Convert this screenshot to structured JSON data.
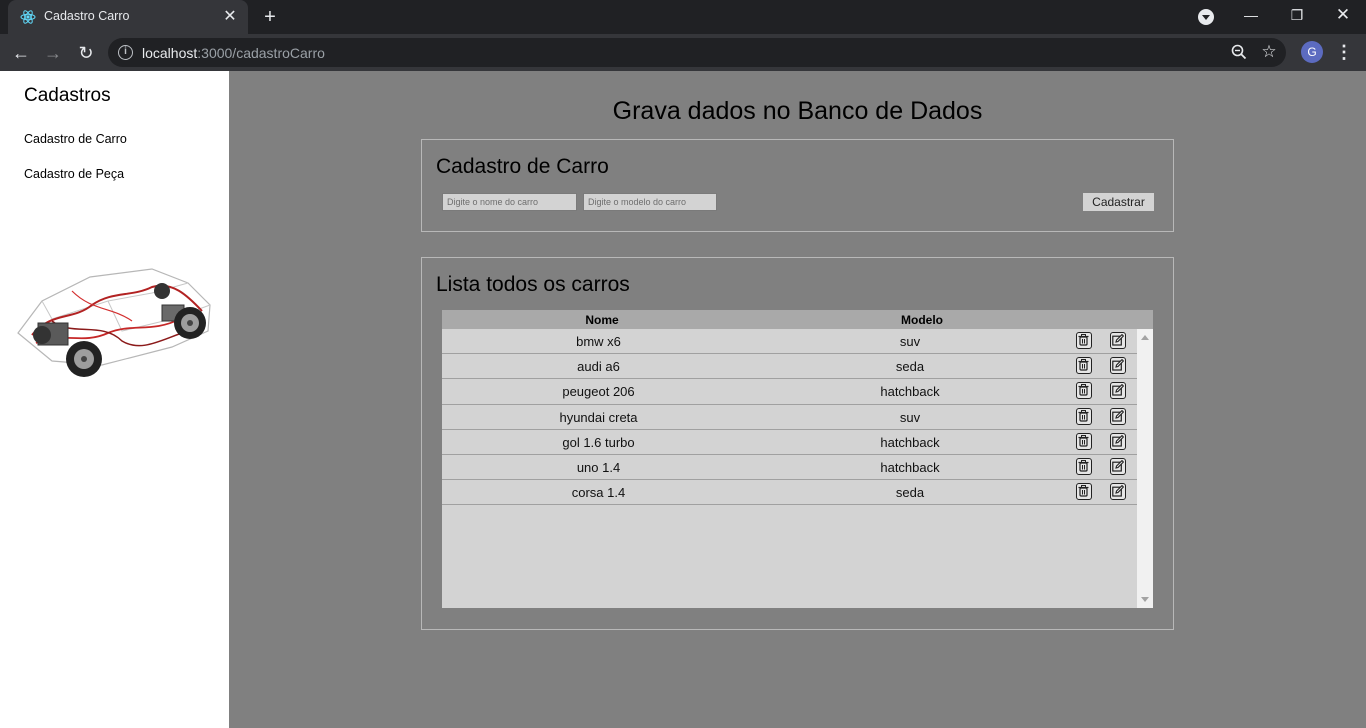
{
  "browser": {
    "tab_title": "Cadastro Carro",
    "url_host": "localhost",
    "url_path": ":3000/cadastroCarro",
    "profile_initial": "G"
  },
  "sidebar": {
    "title": "Cadastros",
    "links": [
      "Cadastro de Carro",
      "Cadastro de Peça"
    ]
  },
  "main": {
    "title": "Grava dados no Banco de Dados",
    "form": {
      "title": "Cadastro de Carro",
      "name_placeholder": "Digite o nome do carro",
      "model_placeholder": "Digite o modelo do carro",
      "submit_label": "Cadastrar"
    },
    "list": {
      "title": "Lista todos os carros",
      "columns": [
        "Nome",
        "Modelo"
      ],
      "rows": [
        {
          "nome": "bmw x6",
          "modelo": "suv"
        },
        {
          "nome": "audi a6",
          "modelo": "seda"
        },
        {
          "nome": "peugeot 206",
          "modelo": "hatchback"
        },
        {
          "nome": "hyundai creta",
          "modelo": "suv"
        },
        {
          "nome": "gol 1.6 turbo",
          "modelo": "hatchback"
        },
        {
          "nome": "uno 1.4",
          "modelo": "hatchback"
        },
        {
          "nome": "corsa 1.4",
          "modelo": "seda"
        }
      ]
    }
  },
  "colors": {
    "page_bg": "#808080",
    "sidebar_bg": "#ffffff",
    "table_bg": "#d3d3d3",
    "table_header_bg": "#a9a9a9",
    "chrome_dark": "#202124",
    "chrome_toolbar": "#35363a",
    "avatar": "#5c6bc0"
  },
  "icons": {
    "delete": "trash-icon",
    "edit": "edit-icon"
  }
}
